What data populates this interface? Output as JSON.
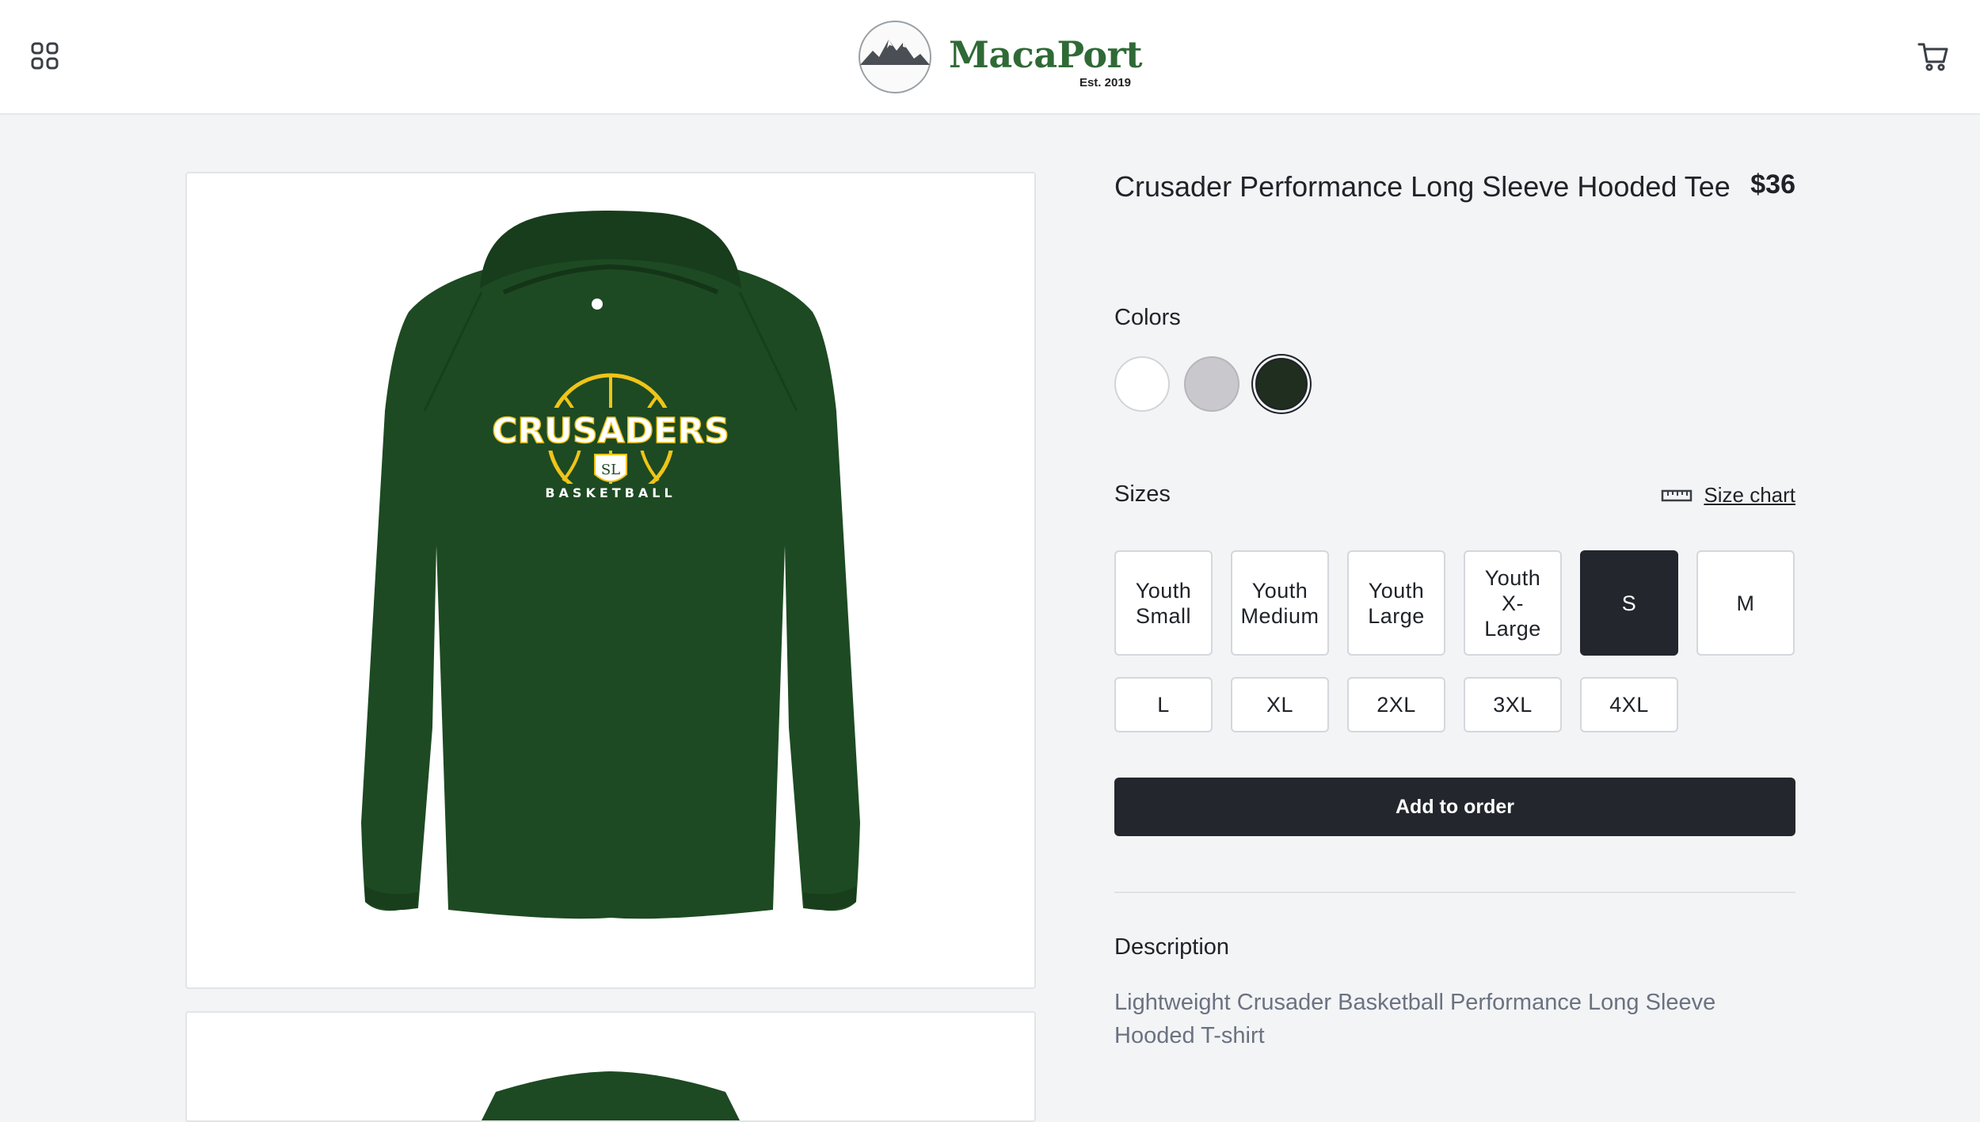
{
  "header": {
    "brand_name": "MacaPort",
    "brand_est": "Est. 2019",
    "menu_icon": "grid-icon",
    "cart_icon": "cart-icon"
  },
  "product": {
    "title": "Crusader Performance Long Sleeve Hooded Tee",
    "price": "$36",
    "graphic_text": {
      "team": "CRUSADERS",
      "sport": "BASKETBALL",
      "monogram": "SL"
    }
  },
  "colors": {
    "label": "Colors",
    "options": [
      {
        "name": "white",
        "hex": "#ffffff"
      },
      {
        "name": "gray",
        "hex": "#c9c9cd"
      },
      {
        "name": "forest-green",
        "hex": "#1f2e1f"
      }
    ],
    "selected": "forest-green"
  },
  "sizes": {
    "label": "Sizes",
    "size_chart_label": "Size chart",
    "size_chart_icon": "ruler-icon",
    "options": [
      {
        "label": "Youth Small"
      },
      {
        "label": "Youth Medium"
      },
      {
        "label": "Youth Large"
      },
      {
        "label": "Youth X-Large"
      },
      {
        "label": "S"
      },
      {
        "label": "M"
      },
      {
        "label": "L"
      },
      {
        "label": "XL"
      },
      {
        "label": "2XL"
      },
      {
        "label": "3XL"
      },
      {
        "label": "4XL"
      }
    ],
    "selected": "S"
  },
  "actions": {
    "add_to_order": "Add to order"
  },
  "description": {
    "heading": "Description",
    "text": "Lightweight Crusader Basketball Performance Long Sleeve Hooded T-shirt"
  },
  "colors_theme": {
    "brand_green": "#2f6a36",
    "shirt_green": "#1d4a22",
    "accent_yellow": "#f0c419",
    "button_dark": "#23272d"
  }
}
